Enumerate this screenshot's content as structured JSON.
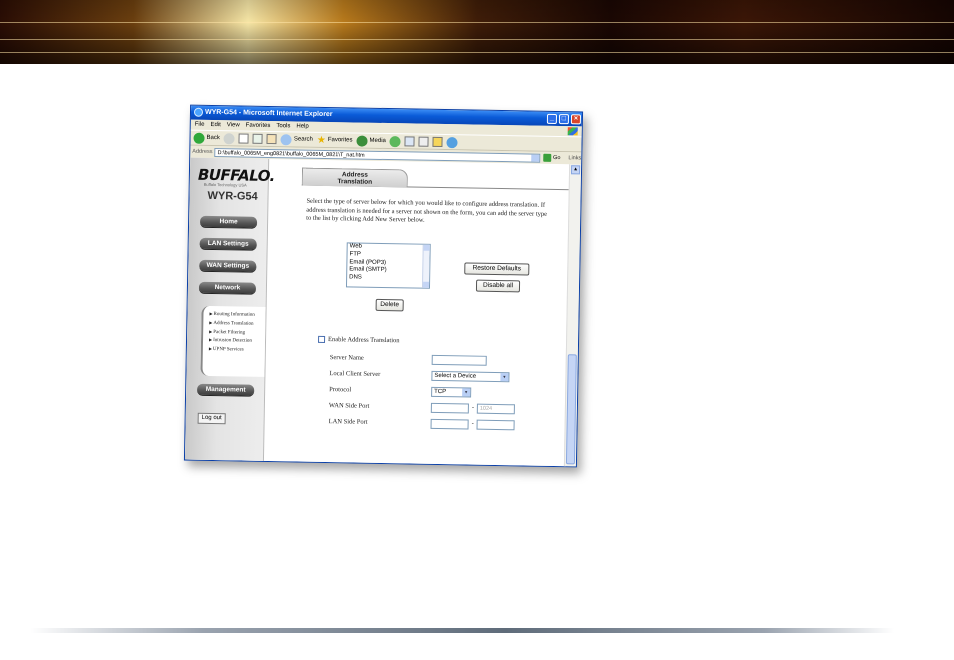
{
  "window": {
    "title": "WYR-G54 - Microsoft Internet Explorer",
    "menu": [
      "File",
      "Edit",
      "View",
      "Favorites",
      "Tools",
      "Help"
    ],
    "toolbar": {
      "back": "Back",
      "search": "Search",
      "favorites": "Favorites",
      "media": "Media"
    },
    "address_label": "Address",
    "address_value": "D:\\buffalo_0065M_eng0821\\buffalo_0065M_0821\\T_nat.htm",
    "go_label": "Go",
    "links_label": "Links"
  },
  "sidebar": {
    "logo": "BUFFALO.",
    "logo_subtitle": "Buffalo Technology USA",
    "model": "WYR-G54",
    "nav": [
      "Home",
      "LAN Settings",
      "WAN Settings",
      "Network"
    ],
    "subnav": [
      "Routing Information",
      "Address Translation",
      "Packet Filtering",
      "Intrusion Detection",
      "UPNP Services"
    ],
    "management": "Management",
    "logout": "Log out"
  },
  "main": {
    "tab_line1": "Address",
    "tab_line2": "Translation",
    "description": "Select the type of server below for which you would like to configure address translation. If address translation is needed for a server not shown on the form, you can add the server type to the list by clicking Add New Server below.",
    "server_types": [
      "Web",
      "FTP",
      "Email (POP3)",
      "Email (SMTP)",
      "DNS"
    ],
    "restore_defaults": "Restore Defaults",
    "disable_all": "Disable all",
    "delete": "Delete",
    "enable_label": "Enable Address Translation",
    "form": {
      "server_name_label": "Server Name",
      "local_client_label": "Local Client Server",
      "local_client_value": "Select a Device",
      "protocol_label": "Protocol",
      "protocol_value": "TCP",
      "wan_port_label": "WAN Side Port",
      "wan_port_end_placeholder": "1024",
      "lan_port_label": "LAN Side Port",
      "dash": "-"
    }
  }
}
